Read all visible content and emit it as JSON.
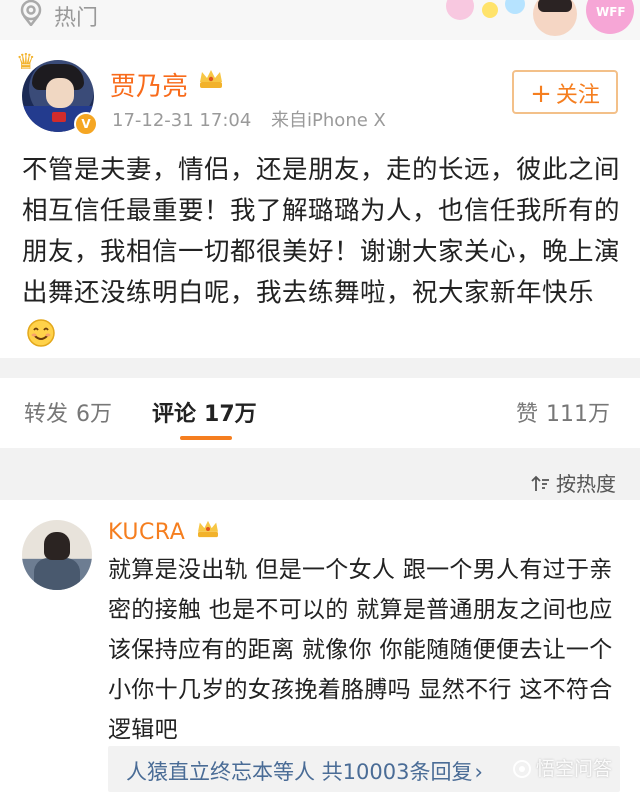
{
  "topbar": {
    "hot_label": "热门"
  },
  "post": {
    "author": "贾乃亮",
    "time": "17-12-31 17:04",
    "source": "来自iPhone X",
    "follow_label": "关注",
    "follow_plus": "+",
    "text": "不管是夫妻，情侣，还是朋友，走的长远，彼此之间相互信任最重要！我了解璐璐为人，也信任我所有的朋友，我相信一切都很美好！谢谢大家关心，晚上演出舞还没练明白呢，我去练舞啦，祝大家新年快乐"
  },
  "tabs": {
    "repost": {
      "label": "转发",
      "count": "6万"
    },
    "comment": {
      "label": "评论",
      "count": "17万"
    },
    "like": {
      "label": "赞",
      "count": "111万"
    }
  },
  "sort": {
    "label": "按热度"
  },
  "comment": {
    "name": "KUCRA",
    "text": "就算是没出轨 但是一个女人 跟一个男人有过于亲密的接触 也是不可以的 就算是普通朋友之间也应该保持应有的距离 就像你 你能随随便便去让一个小你十几岁的女孩挽着胳膊吗 显然不行 这不符合逻辑吧",
    "reply_text": "人猿直立终忘本等人  共10003条回复",
    "reply_arrow": "›"
  },
  "watermark": {
    "text": "悟空问答"
  },
  "colors": {
    "accent_orange": "#f57e1f",
    "link_blue": "#4a6c96",
    "gold": "#f2b22b"
  },
  "icons": [
    "location-pin-icon",
    "crown-icon",
    "verified-badge-icon",
    "plus-icon",
    "smile-emoji-icon",
    "sort-icon",
    "watermark-logo-icon"
  ]
}
